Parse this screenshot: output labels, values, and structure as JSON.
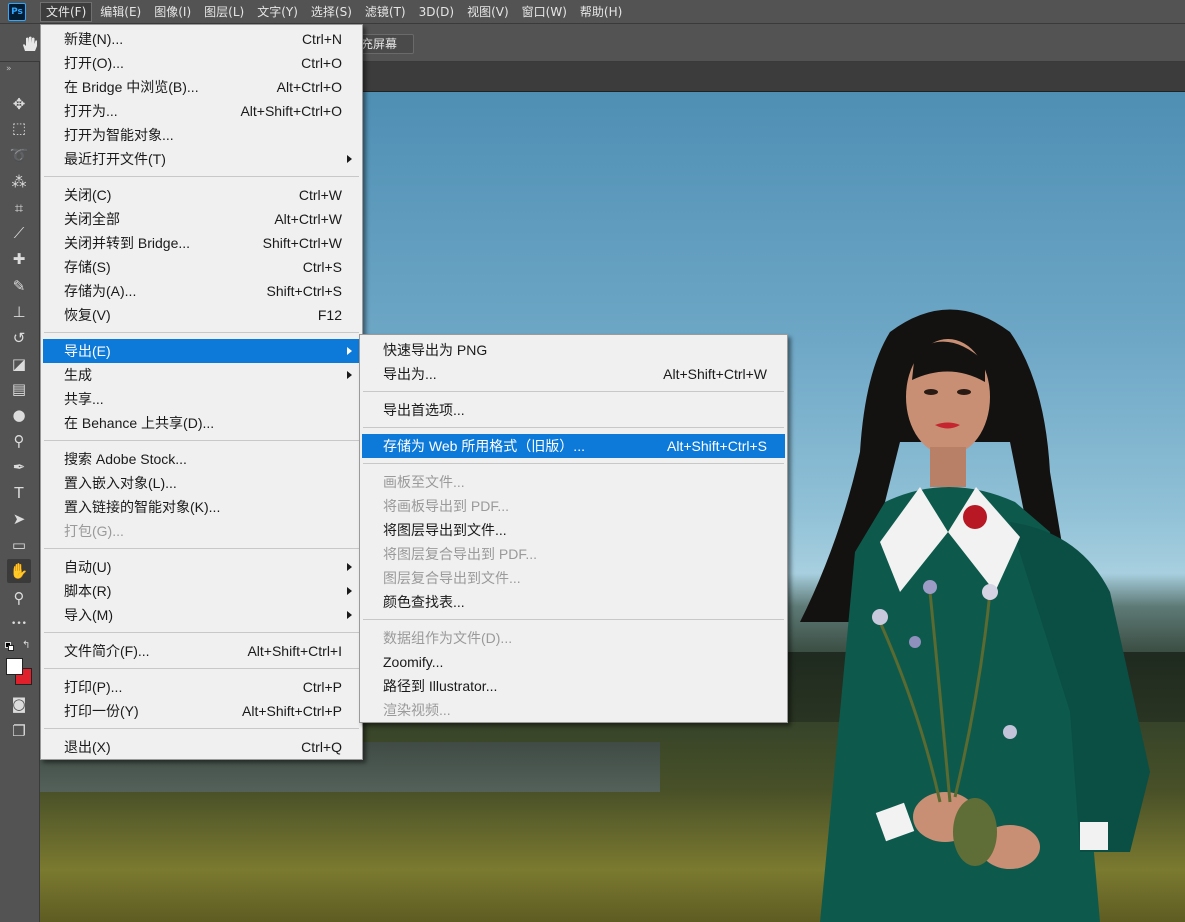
{
  "menubar": {
    "logo": "Ps",
    "items": [
      "文件(F)",
      "编辑(E)",
      "图像(I)",
      "图层(L)",
      "文字(Y)",
      "选择(S)",
      "滤镜(T)",
      "3D(D)",
      "视图(V)",
      "窗口(W)",
      "帮助(H)"
    ],
    "active_index": 0
  },
  "options_bar": {
    "tool_icon": "hand-icon",
    "fill_screen_label": "充屏幕"
  },
  "toolbar": {
    "tools": [
      {
        "name": "move-tool",
        "icon": "move-icon",
        "glyph": "✥"
      },
      {
        "name": "marquee-tool",
        "icon": "marquee-icon",
        "glyph": "⬚"
      },
      {
        "name": "lasso-tool",
        "icon": "lasso-icon",
        "glyph": "➰"
      },
      {
        "name": "quick-select-tool",
        "icon": "quick-select-icon",
        "glyph": "⁂"
      },
      {
        "name": "crop-tool",
        "icon": "crop-icon",
        "glyph": "⌗"
      },
      {
        "name": "eyedropper-tool",
        "icon": "eyedropper-icon",
        "glyph": "⟋"
      },
      {
        "name": "healing-tool",
        "icon": "bandage-icon",
        "glyph": "✚"
      },
      {
        "name": "brush-tool",
        "icon": "brush-icon",
        "glyph": "✎"
      },
      {
        "name": "stamp-tool",
        "icon": "stamp-icon",
        "glyph": "⊥"
      },
      {
        "name": "history-brush-tool",
        "icon": "history-brush-icon",
        "glyph": "↺"
      },
      {
        "name": "eraser-tool",
        "icon": "eraser-icon",
        "glyph": "◪"
      },
      {
        "name": "gradient-tool",
        "icon": "gradient-icon",
        "glyph": "▤"
      },
      {
        "name": "blur-tool",
        "icon": "blur-icon",
        "glyph": "●"
      },
      {
        "name": "dodge-tool",
        "icon": "dodge-icon",
        "glyph": "⚲"
      },
      {
        "name": "pen-tool",
        "icon": "pen-icon",
        "glyph": "✒"
      },
      {
        "name": "type-tool",
        "icon": "type-icon",
        "glyph": "T"
      },
      {
        "name": "path-select-tool",
        "icon": "path-select-icon",
        "glyph": "➤"
      },
      {
        "name": "shape-tool",
        "icon": "rectangle-icon",
        "glyph": "▭"
      },
      {
        "name": "hand-tool",
        "icon": "hand-icon",
        "glyph": "✋"
      },
      {
        "name": "zoom-tool",
        "icon": "zoom-icon",
        "glyph": "⚲"
      },
      {
        "name": "more-tools",
        "icon": "ellipsis-icon",
        "glyph": "•••"
      }
    ],
    "selected_index": 18,
    "foreground_color": "#ffffff",
    "background_color": "#e0202a",
    "bottom_tools": [
      {
        "name": "quick-mask-tool",
        "icon": "quick-mask-icon",
        "glyph": "◙"
      },
      {
        "name": "screen-mode-tool",
        "icon": "screen-mode-icon",
        "glyph": "❐"
      }
    ]
  },
  "file_menu": {
    "items": [
      {
        "label": "新建(N)...",
        "shortcut": "Ctrl+N"
      },
      {
        "label": "打开(O)...",
        "shortcut": "Ctrl+O"
      },
      {
        "label": "在 Bridge 中浏览(B)...",
        "shortcut": "Alt+Ctrl+O"
      },
      {
        "label": "打开为...",
        "shortcut": "Alt+Shift+Ctrl+O"
      },
      {
        "label": "打开为智能对象...",
        "shortcut": ""
      },
      {
        "label": "最近打开文件(T)",
        "shortcut": "",
        "submenu": true
      },
      {
        "sep": true
      },
      {
        "label": "关闭(C)",
        "shortcut": "Ctrl+W"
      },
      {
        "label": "关闭全部",
        "shortcut": "Alt+Ctrl+W"
      },
      {
        "label": "关闭并转到 Bridge...",
        "shortcut": "Shift+Ctrl+W"
      },
      {
        "label": "存储(S)",
        "shortcut": "Ctrl+S"
      },
      {
        "label": "存储为(A)...",
        "shortcut": "Shift+Ctrl+S"
      },
      {
        "label": "恢复(V)",
        "shortcut": "F12"
      },
      {
        "sep": true
      },
      {
        "label": "导出(E)",
        "shortcut": "",
        "submenu": true,
        "highlight": true
      },
      {
        "label": "生成",
        "shortcut": "",
        "submenu": true
      },
      {
        "label": "共享...",
        "shortcut": ""
      },
      {
        "label": "在 Behance 上共享(D)...",
        "shortcut": ""
      },
      {
        "sep": true
      },
      {
        "label": "搜索 Adobe Stock...",
        "shortcut": ""
      },
      {
        "label": "置入嵌入对象(L)...",
        "shortcut": ""
      },
      {
        "label": "置入链接的智能对象(K)...",
        "shortcut": ""
      },
      {
        "label": "打包(G)...",
        "shortcut": "",
        "disabled": true
      },
      {
        "sep": true
      },
      {
        "label": "自动(U)",
        "shortcut": "",
        "submenu": true
      },
      {
        "label": "脚本(R)",
        "shortcut": "",
        "submenu": true
      },
      {
        "label": "导入(M)",
        "shortcut": "",
        "submenu": true
      },
      {
        "sep": true
      },
      {
        "label": "文件简介(F)...",
        "shortcut": "Alt+Shift+Ctrl+I"
      },
      {
        "sep": true
      },
      {
        "label": "打印(P)...",
        "shortcut": "Ctrl+P"
      },
      {
        "label": "打印一份(Y)",
        "shortcut": "Alt+Shift+Ctrl+P"
      },
      {
        "sep": true
      },
      {
        "label": "退出(X)",
        "shortcut": "Ctrl+Q"
      }
    ]
  },
  "export_menu": {
    "items": [
      {
        "label": "快速导出为 PNG",
        "shortcut": ""
      },
      {
        "label": "导出为...",
        "shortcut": "Alt+Shift+Ctrl+W"
      },
      {
        "sep": true
      },
      {
        "label": "导出首选项...",
        "shortcut": ""
      },
      {
        "sep": true
      },
      {
        "label": "存储为 Web 所用格式（旧版）...",
        "shortcut": "Alt+Shift+Ctrl+S",
        "highlight": true
      },
      {
        "sep": true
      },
      {
        "label": "画板至文件...",
        "shortcut": "",
        "disabled": true
      },
      {
        "label": "将画板导出到 PDF...",
        "shortcut": "",
        "disabled": true
      },
      {
        "label": "将图层导出到文件...",
        "shortcut": ""
      },
      {
        "label": "将图层复合导出到 PDF...",
        "shortcut": "",
        "disabled": true
      },
      {
        "label": "图层复合导出到文件...",
        "shortcut": "",
        "disabled": true
      },
      {
        "label": "颜色查找表...",
        "shortcut": ""
      },
      {
        "sep": true
      },
      {
        "label": "数据组作为文件(D)...",
        "shortcut": "",
        "disabled": true
      },
      {
        "label": "Zoomify...",
        "shortcut": ""
      },
      {
        "label": "路径到 Illustrator...",
        "shortcut": ""
      },
      {
        "label": "渲染视频...",
        "shortcut": "",
        "disabled": true
      }
    ]
  },
  "colors": {
    "menu_highlight": "#0d7ad9",
    "chrome": "#535353",
    "menu_bg": "#f0f0f0"
  }
}
